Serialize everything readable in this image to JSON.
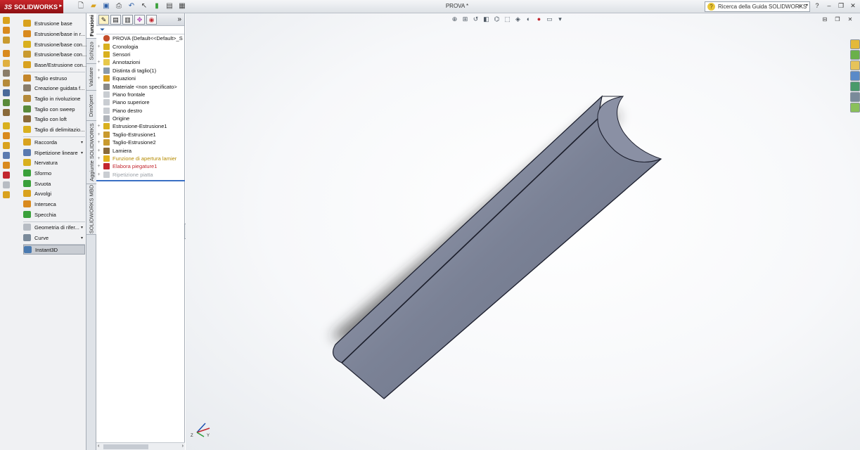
{
  "app": {
    "brand": "SOLIDWORKS",
    "brand_prefix": "3S",
    "document_title": "PROVA *",
    "search_placeholder": "Ricerca della Guida SOLIDWORKS"
  },
  "command_manager": {
    "items": [
      {
        "label": "Estrusione base",
        "dropdown": false,
        "color": "#d9a21e"
      },
      {
        "label": "Estrusione/base in r...",
        "dropdown": false,
        "color": "#d98a1e"
      },
      {
        "label": "Estrusione/base con...",
        "dropdown": false,
        "color": "#d9b01e"
      },
      {
        "label": "Estrusione/base con...",
        "dropdown": false,
        "color": "#c99a2e"
      },
      {
        "label": "Base/Estrusione con...",
        "dropdown": false,
        "color": "#d9a21e"
      },
      {
        "label": "Taglio estruso",
        "dropdown": false,
        "color": "#c4862a"
      },
      {
        "label": "Creazione guidata f...",
        "dropdown": false,
        "color": "#8a7d6a"
      },
      {
        "label": "Taglio in rivoluzione",
        "dropdown": false,
        "color": "#b58a3a"
      },
      {
        "label": "Taglio con sweep",
        "dropdown": false,
        "color": "#5a8a3a"
      },
      {
        "label": "Taglio con loft",
        "dropdown": false,
        "color": "#8a6a3a"
      },
      {
        "label": "Taglio di delimitazio...",
        "dropdown": false,
        "color": "#d9b01e"
      },
      {
        "label": "Raccorda",
        "dropdown": true,
        "color": "#d9a21e"
      },
      {
        "label": "Ripetizione lineare",
        "dropdown": true,
        "color": "#5a7ab0"
      },
      {
        "label": "Nervatura",
        "dropdown": false,
        "color": "#d9b01e"
      },
      {
        "label": "Sformo",
        "dropdown": false,
        "color": "#3aa03a"
      },
      {
        "label": "Svuota",
        "dropdown": false,
        "color": "#3aa03a"
      },
      {
        "label": "Avvolgi",
        "dropdown": false,
        "color": "#d9a21e"
      },
      {
        "label": "Interseca",
        "dropdown": false,
        "color": "#d98a1e"
      },
      {
        "label": "Specchia",
        "dropdown": false,
        "color": "#3aa03a"
      },
      {
        "label": "Geometria di rifer...",
        "dropdown": true,
        "color": "#b7bcc3"
      },
      {
        "label": "Curve",
        "dropdown": true,
        "color": "#7a8a9a"
      },
      {
        "label": "Instant3D",
        "dropdown": false,
        "color": "#4a7ab0",
        "selected": true
      }
    ]
  },
  "vertical_tabs": [
    "Funzioni",
    "Schizzo",
    "Valutare",
    "DimXpert",
    "Aggiunte SOLIDWORKS",
    "SOLIDWORKS MBD"
  ],
  "feature_tree": {
    "nodes": [
      {
        "label": "PROVA  (Default<<Default>_S",
        "plus": "",
        "type": "root",
        "color": "#c34d2a"
      },
      {
        "label": "Cronologia",
        "plus": "+",
        "type": "normal",
        "color": "#d9b01e"
      },
      {
        "label": "Sensori",
        "plus": "",
        "type": "normal",
        "color": "#d9b01e"
      },
      {
        "label": "Annotazioni",
        "plus": "+",
        "type": "normal",
        "color": "#e7c84a"
      },
      {
        "label": "Distinta di taglio(1)",
        "plus": "+",
        "type": "normal",
        "color": "#8a9aaa"
      },
      {
        "label": "Equazioni",
        "plus": "+",
        "type": "normal",
        "color": "#d9a21e"
      },
      {
        "label": "Materiale <non specificato>",
        "plus": "",
        "type": "normal",
        "color": "#8a8a8a"
      },
      {
        "label": "Piano frontale",
        "plus": "",
        "type": "normal",
        "color": "#c9cdd2"
      },
      {
        "label": "Piano superiore",
        "plus": "",
        "type": "normal",
        "color": "#c9cdd2"
      },
      {
        "label": "Piano destro",
        "plus": "",
        "type": "normal",
        "color": "#c9cdd2"
      },
      {
        "label": "Origine",
        "plus": "",
        "type": "normal",
        "color": "#b0b4ba"
      },
      {
        "label": "Estrusione-Estrusione1",
        "plus": "+",
        "type": "normal",
        "color": "#d9b01e"
      },
      {
        "label": "Taglio-Estrusione1",
        "plus": "+",
        "type": "normal",
        "color": "#c99a2e"
      },
      {
        "label": "Taglio-Estrusione2",
        "plus": "+",
        "type": "normal",
        "color": "#c99a2e"
      },
      {
        "label": "Lamiera",
        "plus": "+",
        "type": "normal",
        "color": "#8a6a3a"
      },
      {
        "label": "Funzione di apertura lamier",
        "plus": "+",
        "type": "warn",
        "color": "#e2b21e"
      },
      {
        "label": "Elabora piegature1",
        "plus": "+",
        "type": "err",
        "color": "#c2262e"
      },
      {
        "label": "Ripetizione piatta",
        "plus": "+",
        "type": "dim",
        "color": "#c9cdd2"
      }
    ]
  },
  "viewport": {
    "background": "#ffffff",
    "model_color": "#7b8296",
    "triad_labels": [
      "Z",
      "Y"
    ]
  }
}
